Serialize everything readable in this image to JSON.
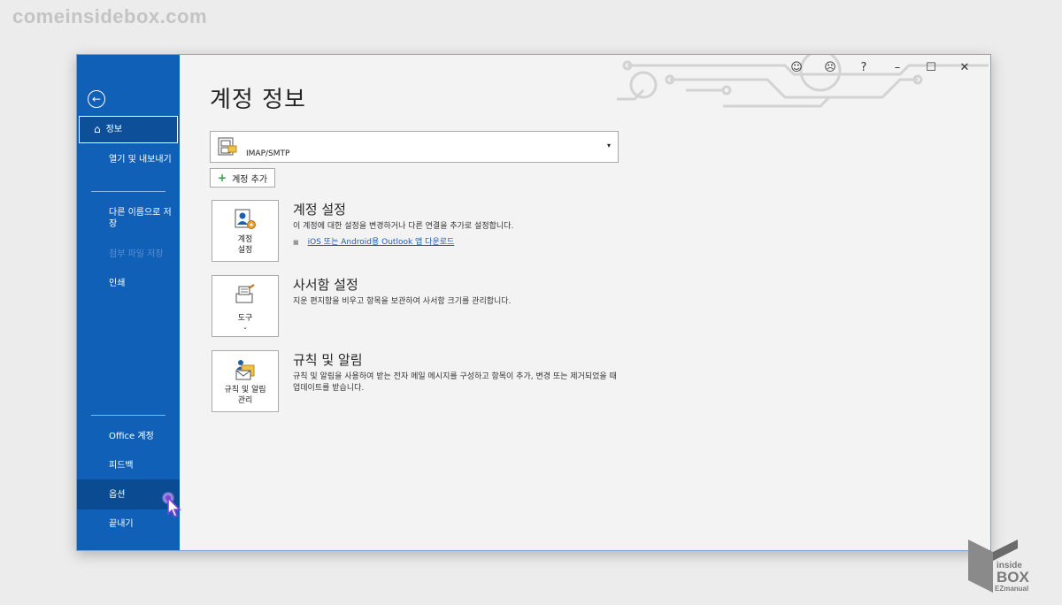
{
  "watermark": "comeinsidebox.com",
  "sidebar": {
    "back_icon": "back-arrow-icon",
    "items": {
      "info": "정보",
      "open_export": "열기 및 내보내기",
      "save_as": "다른 이름으로 저장",
      "save_attachments": "첨부 파일 저장",
      "print": "인쇄",
      "office_account": "Office 계정",
      "feedback": "피드백",
      "options": "옵션",
      "exit": "끝내기"
    }
  },
  "titlebar": {
    "smile": "☺",
    "frown": "☹",
    "help": "?",
    "minimize": "–",
    "maximize": "☐",
    "close": "✕"
  },
  "main": {
    "title": "계정 정보",
    "account": {
      "name": "IMAP/SMTP",
      "caret": "▾"
    },
    "add_account": {
      "plus": "+",
      "label": "계정 추가"
    },
    "sections": [
      {
        "tile_label": "계정\n설정",
        "title": "계정 설정",
        "desc": "이 계정에 대한 설정을 변경하거나 다른 연결을 추가로 설정합니다.",
        "link": "iOS 또는 Android용 Outlook 앱 다운로드"
      },
      {
        "tile_label": "도구",
        "title": "사서함 설정",
        "desc": "지운 편지함을 비우고 항목을 보관하여 사서함 크기를 관리합니다."
      },
      {
        "tile_label": "규칙 및 알림\n관리",
        "title": "규칙 및 알림",
        "desc": "규칙 및 알림을 사용하여 받는 전자 메일 메시지를 구성하고 항목이 추가, 변경 또는 제거되었을 때 업데이트를 받습니다."
      }
    ]
  },
  "logo": {
    "line1": "inside",
    "line2": "BOX",
    "line3": "EZmanual"
  }
}
